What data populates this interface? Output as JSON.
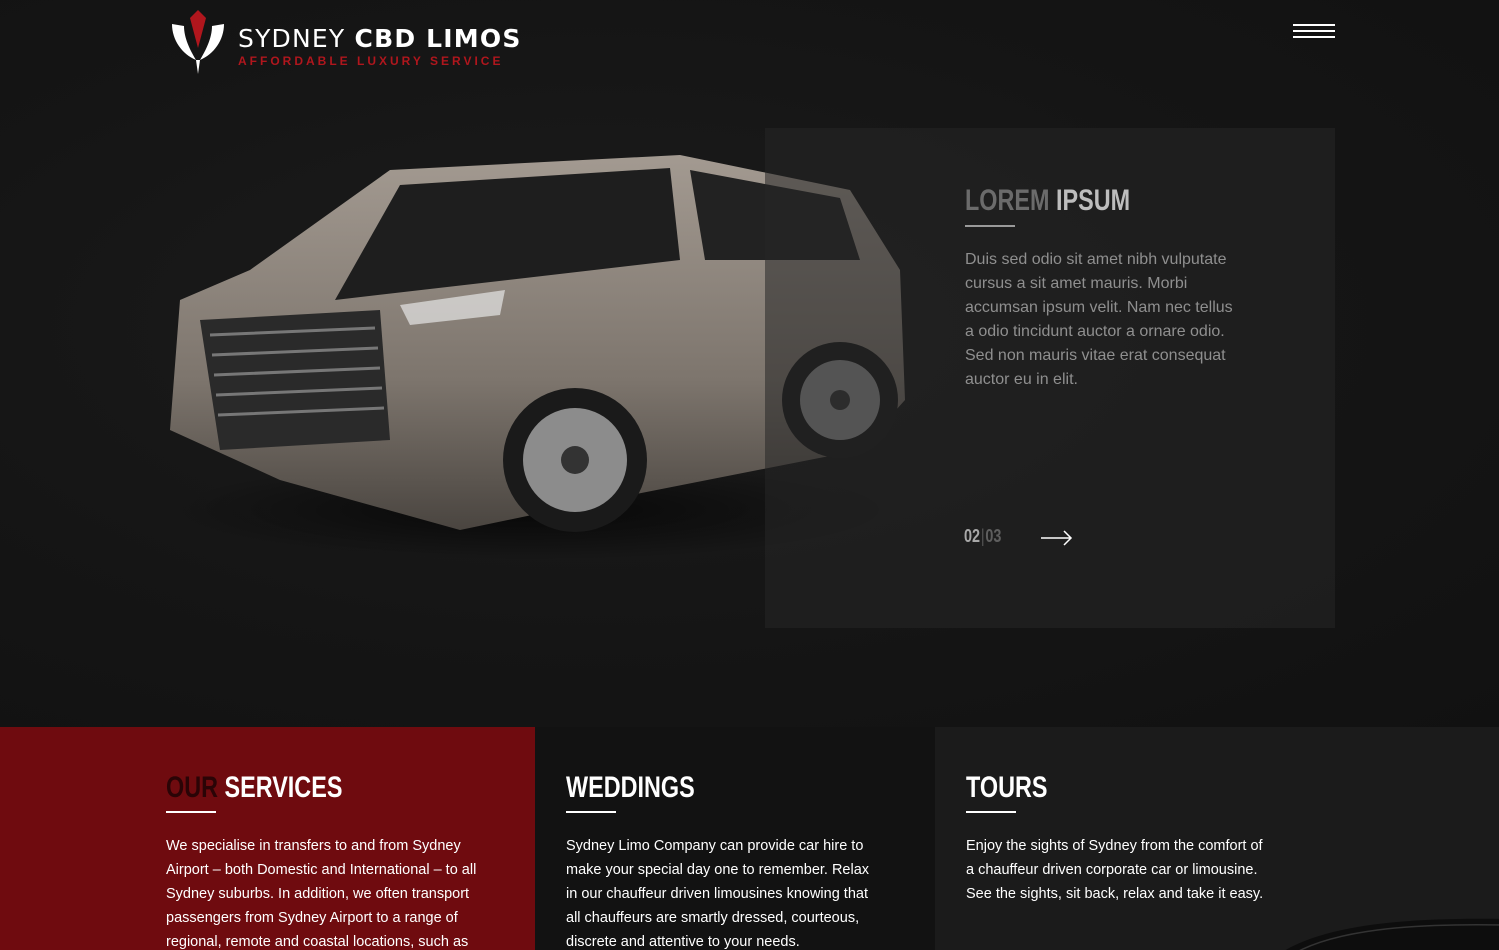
{
  "header": {
    "brand_light": "SYDNEY",
    "brand_bold": "CBD LIMOS",
    "tagline": "AFFORDABLE LUXURY SERVICE"
  },
  "slide": {
    "title_1": "LOREM",
    "title_2": "IPSUM",
    "text": "Duis sed odio sit amet nibh vulputate cursus a sit amet mauris. Morbi accumsan ipsum velit. Nam nec tellus a odio tincidunt auctor a ornare odio. Sed non  mauris vitae erat consequat auctor eu in elit.",
    "current": "02",
    "separator": "|",
    "total": "03"
  },
  "services": {
    "title_1": "OUR",
    "title_2": "SERVICES",
    "text": "We specialise in transfers to and from Sydney Airport – both Domestic and International – to all Sydney suburbs. In addition, we often transport passengers from Sydney Airport to a range of regional, remote and coastal locations, such as"
  },
  "weddings": {
    "title": "WEDDINGS",
    "text": "Sydney Limo Company can provide car hire to make your special day one to remember. Relax in our chauffeur driven limousines knowing that all chauffeurs are smartly dressed, courteous, discrete and attentive to your needs."
  },
  "tours": {
    "title": "TOURS",
    "text": "Enjoy the sights of Sydney from the comfort of a chauffeur driven corporate car or limousine. See the sights, sit back, relax and take it easy."
  },
  "colors": {
    "accent_red": "#b0161d",
    "services_bg": "#6f0b0f",
    "weddings_bg": "#121212",
    "tours_bg": "#1b1b1b"
  }
}
